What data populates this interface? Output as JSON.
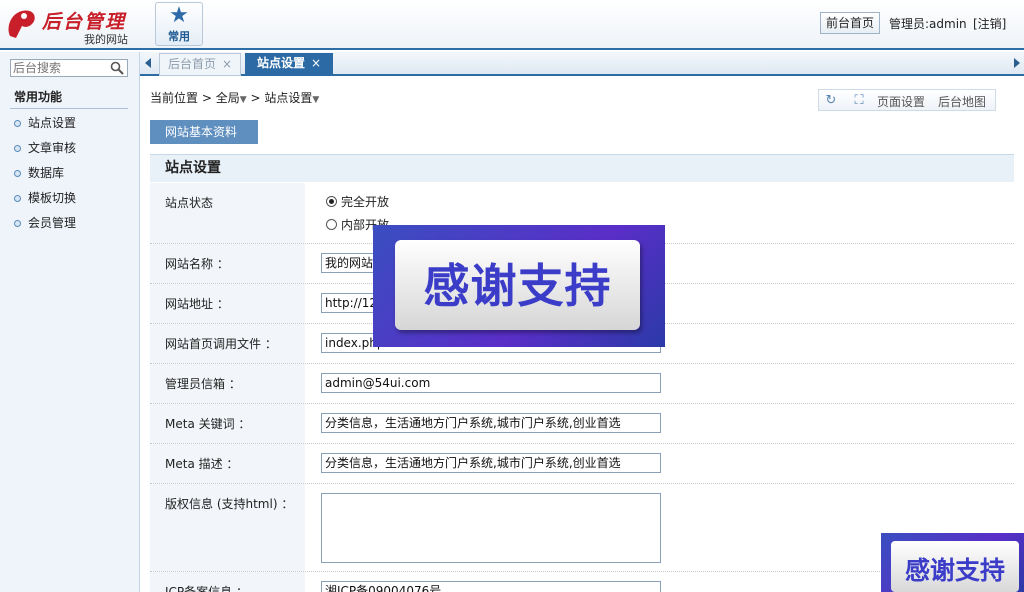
{
  "header": {
    "logo_title": "后台管理",
    "logo_subtitle": "我的网站",
    "common_tab_label": "常用",
    "front_home_button": "前台首页",
    "admin_label": "管理员:admin",
    "logout_label": "[注销]"
  },
  "sidebar": {
    "search_placeholder": "后台搜索",
    "section_title": "常用功能",
    "items": [
      {
        "label": "站点设置"
      },
      {
        "label": "文章审核"
      },
      {
        "label": "数据库"
      },
      {
        "label": "模板切换"
      },
      {
        "label": "会员管理"
      }
    ]
  },
  "tabs": [
    {
      "label": "后台首页",
      "active": false
    },
    {
      "label": "站点设置",
      "active": true
    }
  ],
  "breadcrumb": {
    "prefix": "当前位置",
    "level1": "全局",
    "level2": "站点设置"
  },
  "toolbar": {
    "page_settings": "页面设置",
    "sitemap": "后台地图"
  },
  "section_button": "网站基本资料",
  "section_title": "站点设置",
  "form": {
    "site_status": {
      "label": "站点状态",
      "options": [
        "完全开放",
        "内部开放"
      ],
      "selected": "完全开放"
    },
    "site_name": {
      "label": "网站名称 ：",
      "value": "我的网站"
    },
    "site_url": {
      "label": "网站地址 ：",
      "value": "http://127"
    },
    "index_file": {
      "label": "网站首页调用文件 ：",
      "value": "index.php"
    },
    "admin_email": {
      "label": "管理员信箱 ：",
      "value": "admin@54ui.com"
    },
    "meta_keywords": {
      "label": "Meta 关键词 ：",
      "value": "分类信息，生活通地方门户系统,城市门户系统,创业首选"
    },
    "meta_description": {
      "label": "Meta 描述 ：",
      "value": "分类信息，生活通地方门户系统,城市门户系统,创业首选"
    },
    "copyright": {
      "label": "版权信息 (支持html) ：",
      "value": ""
    },
    "icp": {
      "label": "ICP备案信息 ：",
      "value": "湘ICP备09004076号"
    }
  },
  "overlay": {
    "text": "感谢支持"
  },
  "colors": {
    "accent_blue": "#2c6aa6",
    "brand_red": "#c8202a",
    "overlay_purple": "#5a2ec8"
  }
}
